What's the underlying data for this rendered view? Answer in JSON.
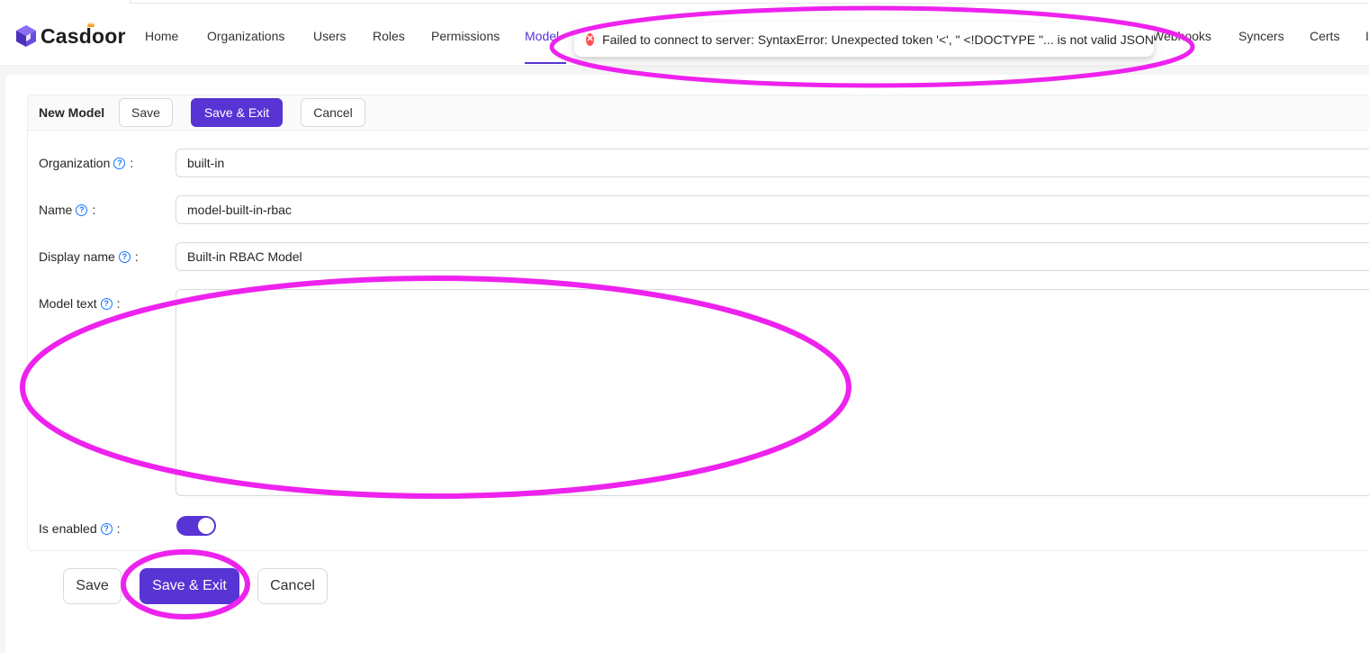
{
  "app": {
    "name": "Casdoor"
  },
  "nav": {
    "items": [
      {
        "label": "Home"
      },
      {
        "label": "Organizations"
      },
      {
        "label": "Users"
      },
      {
        "label": "Roles"
      },
      {
        "label": "Permissions"
      },
      {
        "label": "Model"
      },
      {
        "label": "Webhooks"
      },
      {
        "label": "Syncers"
      },
      {
        "label": "Certs"
      },
      {
        "label": "I"
      }
    ],
    "active": "Models"
  },
  "toast": {
    "type": "error",
    "message": "Failed to connect to server: SyntaxError: Unexpected token '<', \" <!DOCTYPE \"... is not valid JSON"
  },
  "form": {
    "title": "New Model",
    "header_buttons": {
      "save": "Save",
      "save_exit": "Save & Exit",
      "cancel": "Cancel"
    },
    "fields": {
      "organization": {
        "label": "Organization",
        "value": "built-in"
      },
      "name": {
        "label": "Name",
        "value": "model-built-in-rbac"
      },
      "display_name": {
        "label": "Display name",
        "value": "Built-in RBAC Model"
      },
      "model_text": {
        "label": "Model text",
        "value": ""
      },
      "is_enabled": {
        "label": "Is enabled",
        "value": true
      }
    },
    "footer_buttons": {
      "save": "Save",
      "save_exit": "Save & Exit",
      "cancel": "Cancel"
    }
  },
  "colors": {
    "accent": "#5734d3",
    "error": "#ff4d4f",
    "annotation": "#ee22ee"
  }
}
